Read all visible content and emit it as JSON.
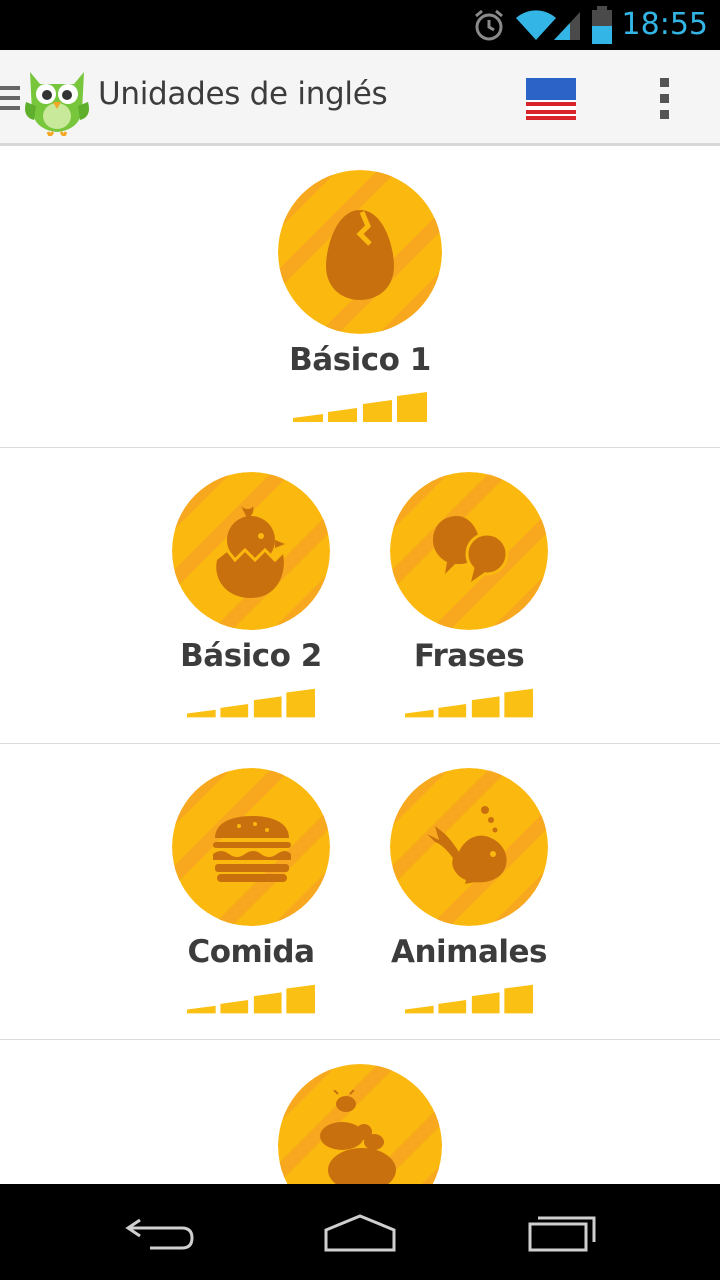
{
  "status_bar": {
    "time": "18:55",
    "icons": [
      "alarm-icon",
      "wifi-icon",
      "signal-icon",
      "battery-icon"
    ],
    "accent_color": "#33b5e5"
  },
  "action_bar": {
    "title": "Unidades de inglés",
    "icons": [
      "hamburger-icon",
      "duolingo-owl-logo",
      "us-flag-icon",
      "overflow-menu-icon"
    ]
  },
  "skills": [
    {
      "name": "Básico 1",
      "icon": "egg-icon",
      "strength_bars": 4
    },
    {
      "name": "Básico 2",
      "icon": "hatching-chick-icon",
      "strength_bars": 4
    },
    {
      "name": "Frases",
      "icon": "speech-bubbles-icon",
      "strength_bars": 4
    },
    {
      "name": "Comida",
      "icon": "hamburger-food-icon",
      "strength_bars": 4
    },
    {
      "name": "Animales",
      "icon": "whale-icon",
      "strength_bars": 4
    },
    {
      "name": "",
      "icon": "bee-icon",
      "strength_bars": 4
    }
  ],
  "colors": {
    "gold": "#fbb80f",
    "gold_stripe": "#f7a722",
    "icon_brown": "#c8700e",
    "strength_bar": "#fbc014",
    "text": "#3c3c3c",
    "divider": "#dcdcdc"
  },
  "nav_bar": {
    "icons": [
      "back-icon",
      "home-icon",
      "recent-apps-icon"
    ]
  }
}
